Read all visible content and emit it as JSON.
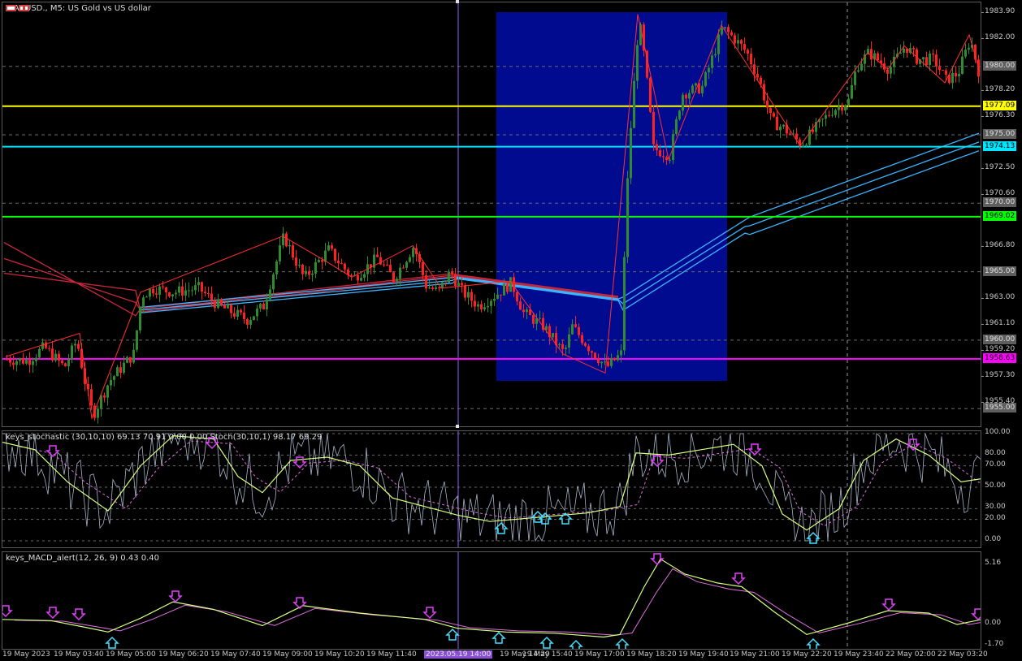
{
  "chart": {
    "symbol_title": "XAUUSD., M5:  US Gold vs US dollar",
    "stoch_title": "keys_stochastic (30,10,10) 69.13 70.91 0.00 0.00 Stoch(30,10,1) 98.17 69.29",
    "macd_title": "keys_MACD_alert(12, 26, 9) 0.43 0.40"
  },
  "price_axis": {
    "ticks": [
      "1983.90",
      "1982.00",
      "1978.20",
      "1976.30",
      "1972.50",
      "1970.60",
      "1966.80",
      "1963.00",
      "1961.10",
      "1959.20",
      "1957.30",
      "1955.40"
    ],
    "boxed_levels": [
      "1980.00",
      "1975.00",
      "1970.00",
      "1965.00",
      "1960.00",
      "1955.00"
    ],
    "price_labels": [
      {
        "text": "1977.09",
        "bg": "#ffff00",
        "fg": "#000000"
      },
      {
        "text": "1974.13",
        "bg": "#00e5ff",
        "fg": "#000000"
      },
      {
        "text": "1969.02",
        "bg": "#00ff00",
        "fg": "#000000"
      },
      {
        "text": "1958.63",
        "bg": "#ff00ff",
        "fg": "#000000"
      }
    ]
  },
  "stoch_axis": {
    "ticks": [
      "100.00",
      "80.00",
      "70.00",
      "50.00",
      "30.00",
      "20.00",
      "0.00"
    ]
  },
  "macd_axis": {
    "ticks": [
      "5.16",
      "0.00",
      "-1.70"
    ]
  },
  "time_axis": {
    "labels": [
      "19 May 2023",
      "19 May 03:40",
      "19 May 05:00",
      "19 May 06:20",
      "19 May 07:40",
      "19 May 09:00",
      "19 May 10:20",
      "19 May 11:40",
      "19 May 14:20",
      "19 May 15:40",
      "19 May 17:00",
      "19 May 18:20",
      "19 May 19:40",
      "19 May 21:00",
      "19 May 22:20",
      "19 May 23:40",
      "22 May 02:00",
      "22 May 03:20"
    ],
    "crosshair_label": "2023.05.19 14:00"
  },
  "colors": {
    "bull": "#2e8b2e",
    "bear": "#ff2020",
    "rect": "#000b8f",
    "yellow": "#ffff00",
    "cyan": "#00e5ff",
    "green": "#00ff00",
    "magenta": "#ff00ff",
    "crosshair": "#9a5cff",
    "ma_blue": "#3cb4ff",
    "ma_red": "#c8283c",
    "arrow_down": "#e040fb",
    "arrow_up": "#40e0ff"
  }
}
